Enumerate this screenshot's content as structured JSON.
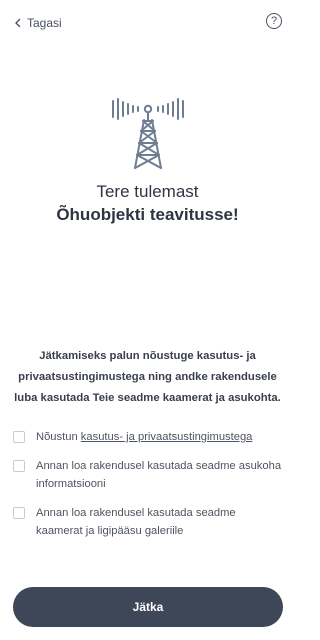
{
  "header": {
    "back_label": "Tagasi",
    "help_glyph": "?"
  },
  "hero": {
    "icon": "radio-tower-icon",
    "greeting": "Tere tulemast",
    "app_name": "Õhuobjekti teavitusse!"
  },
  "intro_text": "Jätkamiseks palun nõustuge kasutus- ja privaatsustingimustega ning andke rakendusele luba kasutada Teie seadme kaamerat ja asukohta.",
  "consents": [
    {
      "prefix": "Nõustun ",
      "link": "kasutus- ja privaatsustingimustega",
      "checked": false
    },
    {
      "text": "Annan loa rakendusel kasutada seadme asukoha informatsiooni",
      "checked": false
    },
    {
      "text": "Annan loa rakendusel kasutada seadme kaamerat ja ligipääsu galeriile",
      "checked": false
    }
  ],
  "continue_label": "Jätka",
  "colors": {
    "button_bg": "#3e4757",
    "icon": "#6f7d93",
    "text": "#333a44"
  }
}
